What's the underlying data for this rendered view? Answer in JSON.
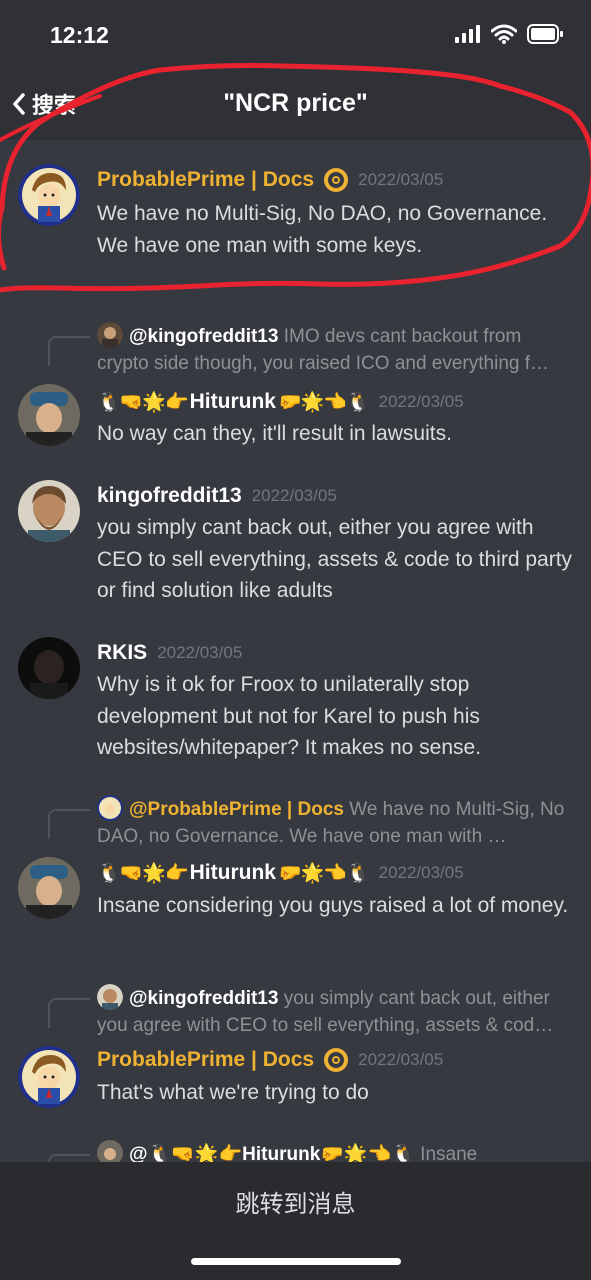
{
  "status_bar": {
    "time": "12:12"
  },
  "header": {
    "back_label": "搜索",
    "title": "\"NCR price\""
  },
  "messages": [
    {
      "author": "ProbablePrime | Docs",
      "timestamp": "2022/03/05",
      "text": "We have no Multi-Sig, No DAO, no Governance. We have one man with some keys."
    },
    {
      "reply_author": "@kingofreddit13",
      "reply_text": "IMO devs cant backout from crypto side though, you raised ICO and everything f…",
      "author_emojis_left": "🐧🤜🌟👉",
      "author": "Hiturunk",
      "author_emojis_right": "🤛🌟👈🐧",
      "timestamp": "2022/03/05",
      "text": "No way can they, it'll result in lawsuits."
    },
    {
      "author": "kingofreddit13",
      "timestamp": "2022/03/05",
      "text": "you simply cant back out, either you agree with CEO to sell everything, assets & code to third party or find solution like adults"
    },
    {
      "author": "RKIS",
      "timestamp": "2022/03/05",
      "text": "Why is it ok for Froox to unilaterally stop development but not for Karel to push his websites/whitepaper? It makes no sense."
    },
    {
      "reply_author": "@ProbablePrime | Docs",
      "reply_text": "We have no Multi-Sig, No DAO, no Governance. We have one man with …",
      "author_emojis_left": "🐧🤜🌟👉",
      "author": "Hiturunk",
      "author_emojis_right": "🤛🌟👈🐧",
      "timestamp": "2022/03/05",
      "text": "Insane considering you guys raised a lot of money."
    },
    {
      "reply_author": "@kingofreddit13",
      "reply_text": "you simply cant back out, either you agree with CEO to sell everything, assets & cod…",
      "author": "ProbablePrime | Docs",
      "timestamp": "2022/03/05",
      "text": "That's what we're trying to do"
    },
    {
      "reply_author": "@🐧🤜🌟👉Hiturunk🤛🌟👈🐧",
      "reply_text": "Insane"
    }
  ],
  "bottom": {
    "jump_label": "跳转到消息"
  },
  "colors": {
    "gold": "#f0b232",
    "background": "#36393f",
    "bar": "#2f3136",
    "scribble": "#e8222e"
  },
  "icons": [
    "chevron-left-icon",
    "signal-icon",
    "wifi-icon",
    "battery-icon",
    "lifebuoy-badge-icon"
  ]
}
